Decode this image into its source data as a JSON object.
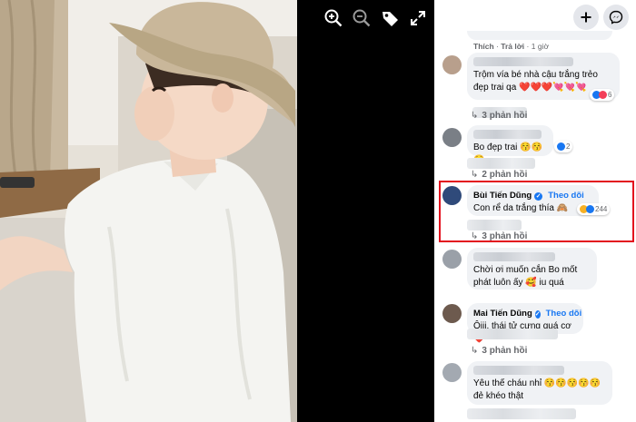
{
  "viewer": {
    "tools": [
      "zoom-in-icon",
      "zoom-out-icon",
      "tag-icon",
      "fullscreen-icon"
    ]
  },
  "panel": {
    "top_buttons": [
      "plus-icon",
      "messenger-icon"
    ],
    "first_meta": {
      "like": "Thích",
      "sep1": "·",
      "reply": "Trả lời",
      "sep2": "·",
      "time": "1 giờ"
    },
    "comments": [
      {
        "id": "c1",
        "author": "",
        "text": "Trộm vía bé nhà cậu trắng trẻo đẹp trai qa ❤️❤️❤️💘💘💘",
        "reactions": "6",
        "replies": "3 phản hồi"
      },
      {
        "id": "c2",
        "author": "",
        "text": "Bo đẹp trai 😚😚😚",
        "reactions": "2",
        "replies": "2 phản hồi"
      },
      {
        "id": "c3",
        "author": "Bùi Tiến Dũng",
        "follow": "Theo dõi",
        "text": "Con rể da trắng thía 🙈",
        "reactions": "244",
        "replies": "3 phản hồi"
      },
      {
        "id": "c4",
        "author": "",
        "text": "Chời ơi muốn cắn Bo mốt phát luôn ấy 🥰 iu quá"
      },
      {
        "id": "c5",
        "author": "Mai Tiến Dũng",
        "follow": "Theo dõi",
        "text": "Ôiii, thái tử cưng quá cơ ❤️",
        "replies": "3 phản hồi"
      },
      {
        "id": "c6",
        "author": "",
        "text": "Yêu thế cháu nhỉ 😚😚😚😚😚 đẻ khéo thật"
      }
    ]
  },
  "colors": {
    "accent": "#1877f2",
    "highlight": "#e3101e",
    "bubble": "#f0f2f5",
    "muted": "#65676b"
  }
}
